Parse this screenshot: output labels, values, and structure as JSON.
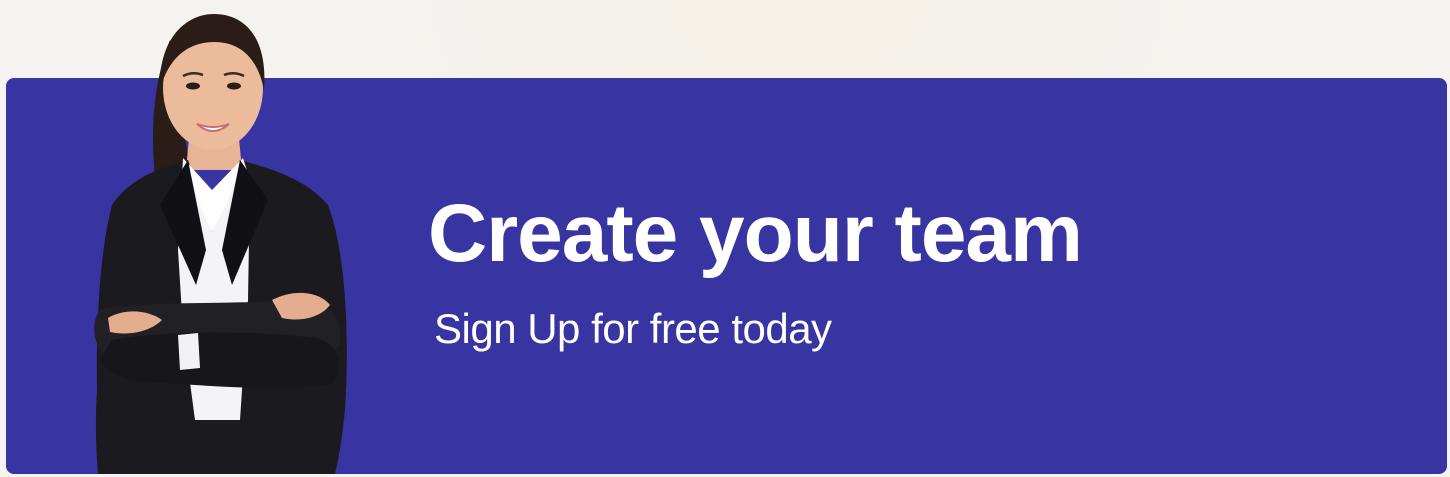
{
  "banner": {
    "title": "Create your team",
    "subtitle": "Sign Up for free today",
    "background_color": "#3834a1",
    "text_color": "#ffffff",
    "image": "businesswoman-arms-crossed"
  }
}
